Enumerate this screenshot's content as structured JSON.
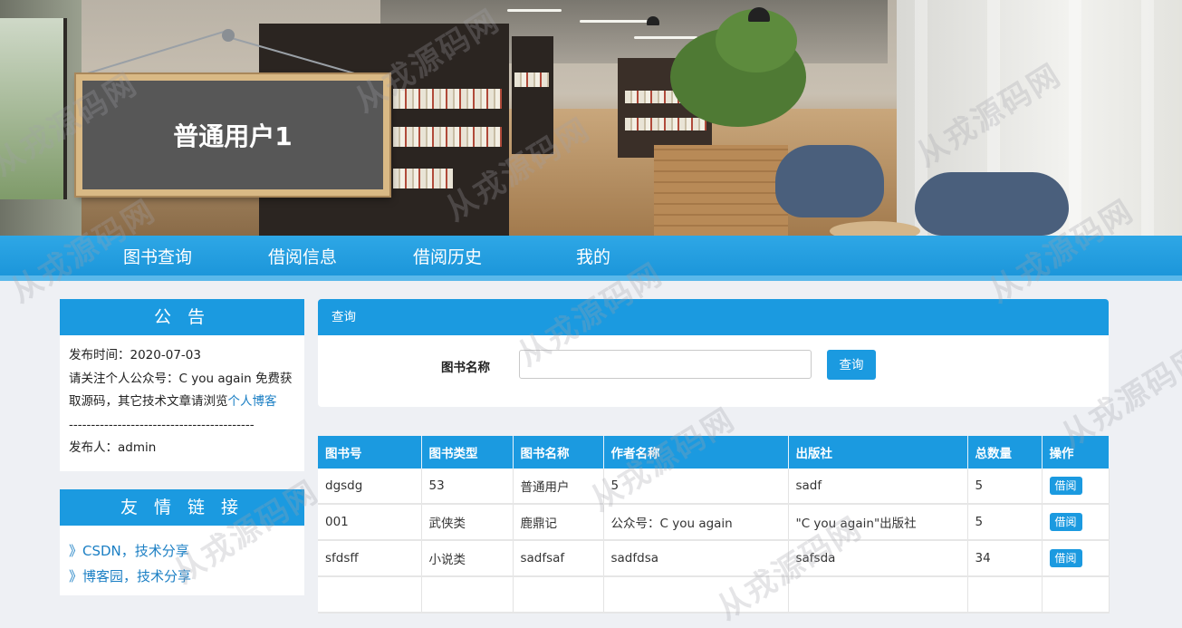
{
  "header": {
    "user_title": "普通用户1"
  },
  "nav": {
    "items": [
      {
        "label": "图书查询"
      },
      {
        "label": "借阅信息"
      },
      {
        "label": "借阅历史"
      },
      {
        "label": "我的"
      }
    ]
  },
  "notice": {
    "title": "公 告",
    "publish_time": "发布时间：2020-07-03",
    "content_text": "请关注个人公众号：C you again 免费获取源码，其它技术文章请浏览",
    "content_link": "个人博客",
    "divider": "--------------------------------------------",
    "publisher": "发布人：admin"
  },
  "links": {
    "title": "友 情 链 接",
    "items": [
      {
        "label": "》CSDN，技术分享"
      },
      {
        "label": "》博客园，技术分享"
      }
    ]
  },
  "query": {
    "header": "查询",
    "label": "图书名称",
    "input_value": "",
    "button": "查询"
  },
  "table": {
    "columns": [
      "图书号",
      "图书类型",
      "图书名称",
      "作者名称",
      "出版社",
      "总数量",
      "操作"
    ],
    "rows": [
      {
        "id": "dgsdg",
        "type": "53",
        "name": "普通用户",
        "author": "5",
        "publisher": "sadf",
        "total": "5",
        "action": "借阅"
      },
      {
        "id": "001",
        "type": "武侠类",
        "name": "鹿鼎记",
        "author": "公众号：C you again",
        "publisher": "\"C you again\"出版社",
        "total": "5",
        "action": "借阅"
      },
      {
        "id": "sfdsff",
        "type": "小说类",
        "name": "sadfsaf",
        "author": "sadfdsa",
        "publisher": "safsda",
        "total": "34",
        "action": "借阅"
      },
      {
        "id": "",
        "type": "",
        "name": "",
        "author": "",
        "publisher": "",
        "total": "",
        "action": ""
      }
    ]
  },
  "watermark": "从戎源码网"
}
